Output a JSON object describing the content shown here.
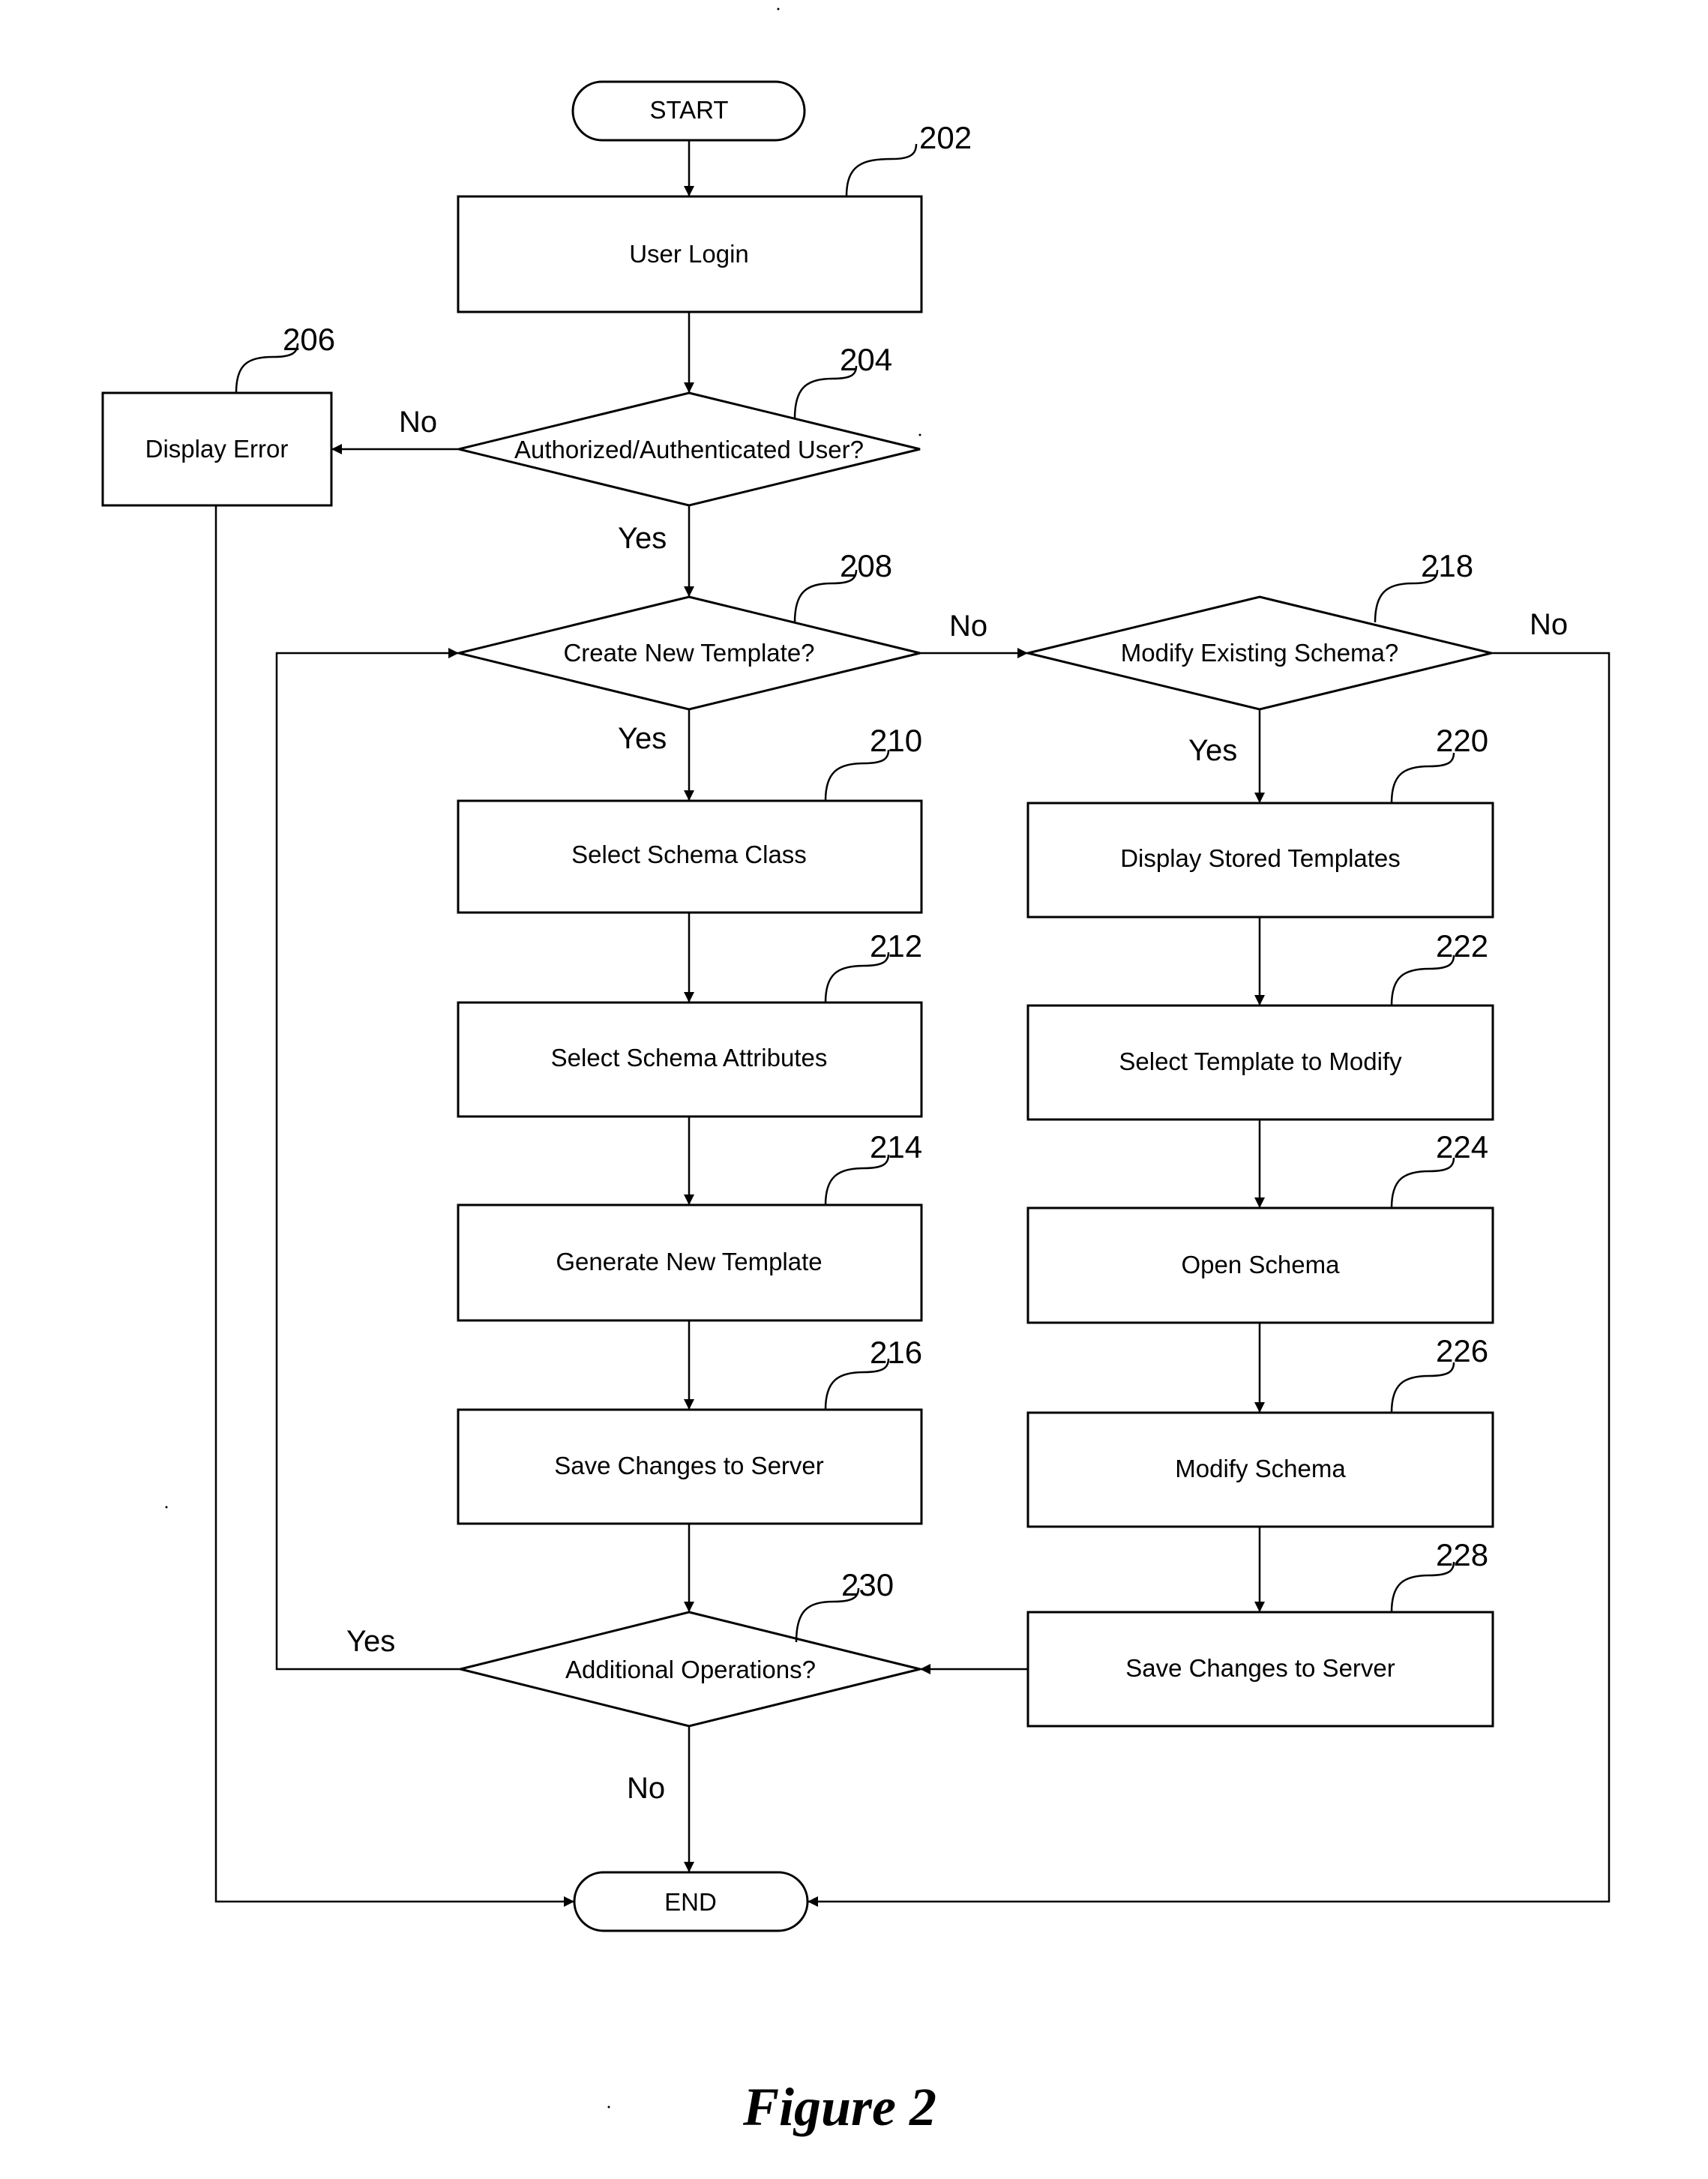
{
  "figure": {
    "caption": "Figure 2"
  },
  "nodes": {
    "start": {
      "label": "START",
      "type": "terminal"
    },
    "n202": {
      "ref": "202",
      "label": "User Login",
      "type": "process"
    },
    "n204": {
      "ref": "204",
      "label": "Authorized/Authenticated User?",
      "type": "decision"
    },
    "n206": {
      "ref": "206",
      "label": "Display Error",
      "type": "process"
    },
    "n208": {
      "ref": "208",
      "label": "Create New Template?",
      "type": "decision"
    },
    "n210": {
      "ref": "210",
      "label": "Select Schema Class",
      "type": "process"
    },
    "n212": {
      "ref": "212",
      "label": "Select Schema Attributes",
      "type": "process"
    },
    "n214": {
      "ref": "214",
      "label": "Generate New Template",
      "type": "process"
    },
    "n216": {
      "ref": "216",
      "label": "Save Changes to Server",
      "type": "process"
    },
    "n218": {
      "ref": "218",
      "label": "Modify Existing Schema?",
      "type": "decision"
    },
    "n220": {
      "ref": "220",
      "label": "Display Stored Templates",
      "type": "process"
    },
    "n222": {
      "ref": "222",
      "label": "Select Template to Modify",
      "type": "process"
    },
    "n224": {
      "ref": "224",
      "label": "Open Schema",
      "type": "process"
    },
    "n226": {
      "ref": "226",
      "label": "Modify Schema",
      "type": "process"
    },
    "n228": {
      "ref": "228",
      "label": "Save Changes to Server",
      "type": "process"
    },
    "n230": {
      "ref": "230",
      "label": "Additional Operations?",
      "type": "decision"
    },
    "end": {
      "label": "END",
      "type": "terminal"
    }
  },
  "branches": {
    "b204_no": "No",
    "b204_yes": "Yes",
    "b208_no": "No",
    "b208_yes": "Yes",
    "b218_no": "No",
    "b218_yes": "Yes",
    "b230_yes": "Yes",
    "b230_no": "No"
  },
  "edges": [
    {
      "from": "start",
      "to": "n202"
    },
    {
      "from": "n202",
      "to": "n204"
    },
    {
      "from": "n204",
      "to": "n206",
      "label": "No"
    },
    {
      "from": "n204",
      "to": "n208",
      "label": "Yes"
    },
    {
      "from": "n206",
      "to": "end"
    },
    {
      "from": "n208",
      "to": "n210",
      "label": "Yes"
    },
    {
      "from": "n208",
      "to": "n218",
      "label": "No"
    },
    {
      "from": "n210",
      "to": "n212"
    },
    {
      "from": "n212",
      "to": "n214"
    },
    {
      "from": "n214",
      "to": "n216"
    },
    {
      "from": "n216",
      "to": "n230"
    },
    {
      "from": "n218",
      "to": "n220",
      "label": "Yes"
    },
    {
      "from": "n218",
      "to": "end",
      "label": "No"
    },
    {
      "from": "n220",
      "to": "n222"
    },
    {
      "from": "n222",
      "to": "n224"
    },
    {
      "from": "n224",
      "to": "n226"
    },
    {
      "from": "n226",
      "to": "n228"
    },
    {
      "from": "n228",
      "to": "n230"
    },
    {
      "from": "n230",
      "to": "n208",
      "label": "Yes"
    },
    {
      "from": "n230",
      "to": "end",
      "label": "No"
    }
  ]
}
